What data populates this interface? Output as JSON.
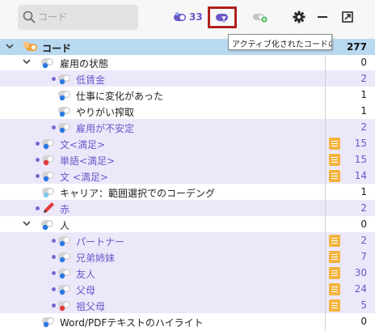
{
  "search": {
    "placeholder": "コード",
    "value": ""
  },
  "toolbar": {
    "codes_count": "33"
  },
  "tooltip": "アクティブ化されたコードのみ",
  "rows": [
    {
      "name": "code-root",
      "label": "コード",
      "count": "277",
      "style": "root",
      "chev": "down",
      "icon": "code-root"
    },
    {
      "name": "koyou-status",
      "label": "雇用の状態",
      "count": "0",
      "style": "plain",
      "chev": "down",
      "icon": "toggle-blue"
    },
    {
      "name": "low-wage",
      "label": "低賃金",
      "count": "2",
      "style": "hl",
      "icon": "toggle-blue",
      "bullet": true
    },
    {
      "name": "job-change",
      "label": "仕事に変化があった",
      "count": "1",
      "style": "plain",
      "icon": "toggle-blue"
    },
    {
      "name": "exploitation",
      "label": "やりがい搾取",
      "count": "1",
      "style": "plain",
      "icon": "toggle-blue"
    },
    {
      "name": "unstable",
      "label": "雇用が不安定",
      "count": "2",
      "style": "hl",
      "icon": "toggle-blue",
      "bullet": true
    },
    {
      "name": "sentence-satisfaction",
      "label": "文<満足>",
      "count": "15",
      "style": "hl",
      "icon": "toggle-blue",
      "bullet": true,
      "memo": true
    },
    {
      "name": "word-satisfaction",
      "label": "単語<満足>",
      "count": "15",
      "style": "hl",
      "icon": "toggle-red",
      "bullet": true,
      "memo": true
    },
    {
      "name": "sentence-satisfaction-2",
      "label": "文 <満足>",
      "count": "14",
      "style": "hl",
      "icon": "toggle-blue",
      "bullet": true,
      "memo": true
    },
    {
      "name": "career-coding",
      "label": "キャリア：範囲選択でのコーデング",
      "count": "1",
      "style": "plain",
      "icon": "toggle-lightblue"
    },
    {
      "name": "red",
      "label": "赤",
      "count": "2",
      "style": "hl",
      "icon": "pen-red",
      "bullet": true
    },
    {
      "name": "person",
      "label": "人",
      "count": "0",
      "style": "plain",
      "chev": "down",
      "icon": "toggle-blue"
    },
    {
      "name": "partner",
      "label": "パートナー",
      "count": "2",
      "style": "hl",
      "icon": "toggle-blue",
      "bullet": true,
      "memo": true
    },
    {
      "name": "siblings",
      "label": "兄弟姉妹",
      "count": "7",
      "style": "hl",
      "icon": "toggle-blue",
      "bullet": true,
      "memo": true
    },
    {
      "name": "friend",
      "label": "友人",
      "count": "30",
      "style": "hl",
      "icon": "toggle-blue",
      "bullet": true,
      "memo": true
    },
    {
      "name": "parents",
      "label": "父母",
      "count": "24",
      "style": "hl",
      "icon": "toggle-blue",
      "bullet": true,
      "memo": true
    },
    {
      "name": "grandparents",
      "label": "祖父母",
      "count": "5",
      "style": "hl",
      "icon": "toggle-red",
      "bullet": true,
      "memo": true
    },
    {
      "name": "word-pdf-highlight",
      "label": "Word/PDFテキストのハイライト",
      "count": "0",
      "style": "plain",
      "icon": "toggle-blue"
    }
  ]
}
